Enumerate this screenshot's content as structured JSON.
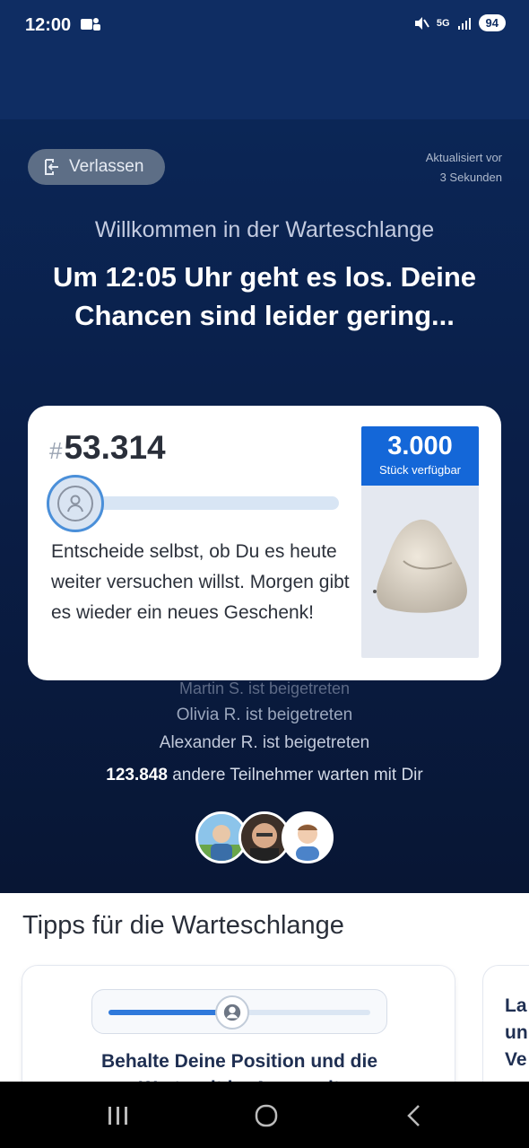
{
  "status_bar": {
    "time": "12:00",
    "network": "5G",
    "battery": "94"
  },
  "top": {
    "leave_label": "Verlassen",
    "updated_line1": "Aktualisiert vor",
    "updated_line2": "3 Sekunden"
  },
  "queue": {
    "welcome": "Willkommen in der Warteschlange",
    "headline": "Um 12:05 Uhr geht es los. Deine Chancen sind leider gering...",
    "position_hash": "#",
    "position": "53.314",
    "progress_fraction": 0.0,
    "message": "Entscheide selbst, ob Du es heute weiter versuchen willst. Morgen gibt es wieder ein neues Geschenk!",
    "stock_number": "3.000",
    "stock_label": "Stück verfügbar"
  },
  "activity": {
    "joined_faded": "Martin S. ist beigetreten",
    "joined_1": "Olivia R. ist beigetreten",
    "joined_2": "Alexander R. ist beigetreten",
    "waiting_count": "123.848",
    "waiting_text": " andere Teilnehmer warten mit Dir"
  },
  "tips": {
    "title": "Tipps für die Warteschlange",
    "card1_title": "Behalte Deine Position und die Wartezeit im Auge, mit Benachrichtigungen",
    "card2_title": "La un Ve"
  },
  "colors": {
    "primary": "#1467d8",
    "header": "#0f2d63",
    "hero_bg": "#0a1e47"
  }
}
